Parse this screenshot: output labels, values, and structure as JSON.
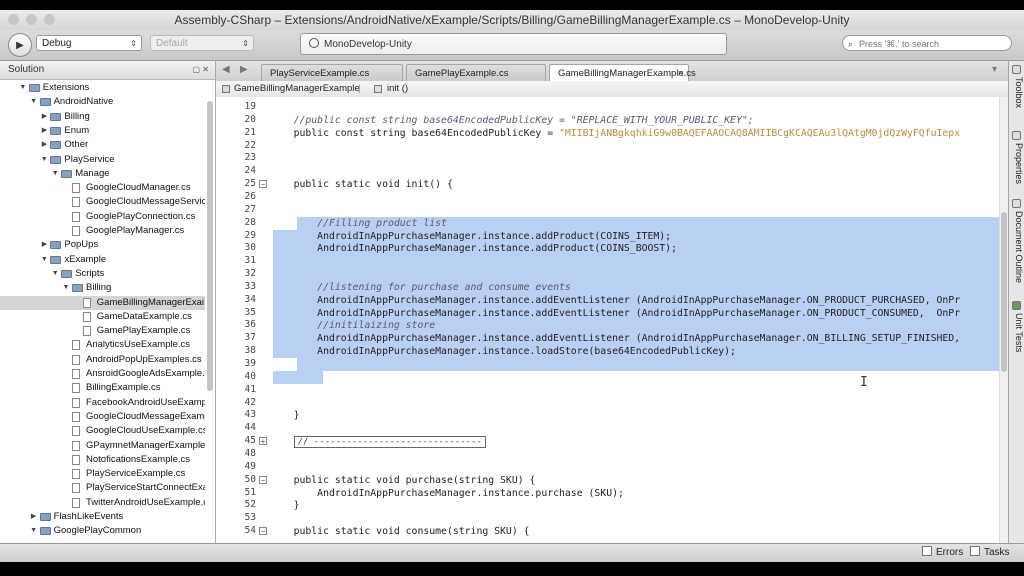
{
  "window": {
    "title": "Assembly-CSharp – Extensions/AndroidNative/xExample/Scripts/Billing/GameBillingManagerExample.cs – MonoDevelop-Unity"
  },
  "toolbar": {
    "config": "Debug",
    "platform": "Default",
    "status": "MonoDevelop-Unity",
    "search_placeholder": "Press '⌘.' to search"
  },
  "solution": {
    "title": "Solution",
    "items": [
      {
        "label": "Extensions",
        "depth": 1,
        "kind": "folder",
        "open": true
      },
      {
        "label": "AndroidNative",
        "depth": 2,
        "kind": "folder",
        "open": true
      },
      {
        "label": "Billing",
        "depth": 3,
        "kind": "folder",
        "open": false
      },
      {
        "label": "Enum",
        "depth": 3,
        "kind": "folder",
        "open": false
      },
      {
        "label": "Other",
        "depth": 3,
        "kind": "folder",
        "open": false
      },
      {
        "label": "PlayService",
        "depth": 3,
        "kind": "folder",
        "open": true
      },
      {
        "label": "Manage",
        "depth": 4,
        "kind": "folder",
        "open": true
      },
      {
        "label": "GoogleCloudManager.cs",
        "depth": 5,
        "kind": "file"
      },
      {
        "label": "GoogleCloudMessageService.cs",
        "depth": 5,
        "kind": "file"
      },
      {
        "label": "GooglePlayConnection.cs",
        "depth": 5,
        "kind": "file"
      },
      {
        "label": "GooglePlayManager.cs",
        "depth": 5,
        "kind": "file"
      },
      {
        "label": "PopUps",
        "depth": 3,
        "kind": "folder",
        "open": false
      },
      {
        "label": "xExample",
        "depth": 3,
        "kind": "folder",
        "open": true
      },
      {
        "label": "Scripts",
        "depth": 4,
        "kind": "folder",
        "open": true
      },
      {
        "label": "Billing",
        "depth": 5,
        "kind": "folder",
        "open": true
      },
      {
        "label": "GameBillingManagerExai",
        "depth": 6,
        "kind": "file",
        "selected": true
      },
      {
        "label": "GameDataExample.cs",
        "depth": 6,
        "kind": "file"
      },
      {
        "label": "GamePlayExample.cs",
        "depth": 6,
        "kind": "file"
      },
      {
        "label": "AnalyticsUseExample.cs",
        "depth": 5,
        "kind": "file"
      },
      {
        "label": "AndroidPopUpExamples.cs",
        "depth": 5,
        "kind": "file"
      },
      {
        "label": "AnsroidGoogleAdsExample.cs",
        "depth": 5,
        "kind": "file"
      },
      {
        "label": "BillingExample.cs",
        "depth": 5,
        "kind": "file"
      },
      {
        "label": "FacebookAndroidUseExample.cs",
        "depth": 5,
        "kind": "file"
      },
      {
        "label": "GoogleCloudMessageExample.",
        "depth": 5,
        "kind": "file"
      },
      {
        "label": "GoogleCloudUseExample.cs",
        "depth": 5,
        "kind": "file"
      },
      {
        "label": "GPaymnetManagerExample.cs",
        "depth": 5,
        "kind": "file"
      },
      {
        "label": "NotoficationsExample.cs",
        "depth": 5,
        "kind": "file"
      },
      {
        "label": "PlayServiceExample.cs",
        "depth": 5,
        "kind": "file"
      },
      {
        "label": "PlayServiceStartConnectExampl",
        "depth": 5,
        "kind": "file"
      },
      {
        "label": "TwitterAndroidUseExample.cs",
        "depth": 5,
        "kind": "file"
      },
      {
        "label": "FlashLikeEvents",
        "depth": 2,
        "kind": "folder",
        "open": false
      },
      {
        "label": "GooglePlayCommon",
        "depth": 2,
        "kind": "folder",
        "open": true
      }
    ]
  },
  "tabs": [
    {
      "label": "PlayServiceExample.cs",
      "active": false
    },
    {
      "label": "GamePlayExample.cs",
      "active": false
    },
    {
      "label": "GameBillingManagerExample.cs",
      "active": true
    }
  ],
  "pathbar": {
    "class_name": "GameBillingManagerExample",
    "member_name": "init ()"
  },
  "code": [
    {
      "n": "19",
      "t": ""
    },
    {
      "n": "20",
      "t": "    //public const string base64EncodedPublicKey = \"REPLACE_WITH_YOUR_PUBLIC_KEY\";",
      "c": true
    },
    {
      "n": "21",
      "t": "    public const string base64EncodedPublicKey = ",
      "s": "\"MIIBIjANBgkqhkiG9w0BAQEFAAOCAQ8AMIIBCgKCAQEAu3lQAtgM0jdQzWyFQfuIepx"
    },
    {
      "n": "22",
      "t": ""
    },
    {
      "n": "23",
      "t": ""
    },
    {
      "n": "24",
      "t": ""
    },
    {
      "n": "25",
      "t": "    public static void init() {",
      "fold": "-"
    },
    {
      "n": "26",
      "t": ""
    },
    {
      "n": "27",
      "t": ""
    },
    {
      "n": "28",
      "t": "        //Filling product list",
      "c": true
    },
    {
      "n": "29",
      "t": "        AndroidInAppPurchaseManager.instance.addProduct(COINS_ITEM);"
    },
    {
      "n": "30",
      "t": "        AndroidInAppPurchaseManager.instance.addProduct(COINS_BOOST);"
    },
    {
      "n": "31",
      "t": ""
    },
    {
      "n": "32",
      "t": ""
    },
    {
      "n": "33",
      "t": "        //listening for purchase and consume events",
      "c": true
    },
    {
      "n": "34",
      "t": "        AndroidInAppPurchaseManager.instance.addEventListener (AndroidInAppPurchaseManager.ON_PRODUCT_PURCHASED, OnPr"
    },
    {
      "n": "35",
      "t": "        AndroidInAppPurchaseManager.instance.addEventListener (AndroidInAppPurchaseManager.ON_PRODUCT_CONSUMED,  OnPr"
    },
    {
      "n": "36",
      "t": "        //initilaizing store",
      "c": true
    },
    {
      "n": "37",
      "t": "        AndroidInAppPurchaseManager.instance.addEventListener (AndroidInAppPurchaseManager.ON_BILLING_SETUP_FINISHED,"
    },
    {
      "n": "38",
      "t": "        AndroidInAppPurchaseManager.instance.loadStore(base64EncodedPublicKey);"
    },
    {
      "n": "39",
      "t": ""
    },
    {
      "n": "40",
      "t": ""
    },
    {
      "n": "41",
      "t": ""
    },
    {
      "n": "42",
      "t": ""
    },
    {
      "n": "43",
      "t": "    }"
    },
    {
      "n": "44",
      "t": ""
    },
    {
      "n": "45",
      "t": "    // -------------------------------",
      "box": true,
      "fold": "+"
    },
    {
      "n": "48",
      "t": ""
    },
    {
      "n": "49",
      "t": ""
    },
    {
      "n": "50",
      "t": "    public static void purchase(string SKU) {",
      "fold": "-"
    },
    {
      "n": "51",
      "t": "        AndroidInAppPurchaseManager.instance.purchase (SKU);"
    },
    {
      "n": "52",
      "t": "    }"
    },
    {
      "n": "53",
      "t": ""
    },
    {
      "n": "54",
      "t": "    public static void consume(string SKU) {",
      "fold": "-"
    }
  ],
  "right_dock": [
    "Toolbox",
    "Properties",
    "Document Outline",
    "Unit Tests"
  ],
  "statusbar": {
    "errors": "Errors",
    "tasks": "Tasks"
  }
}
